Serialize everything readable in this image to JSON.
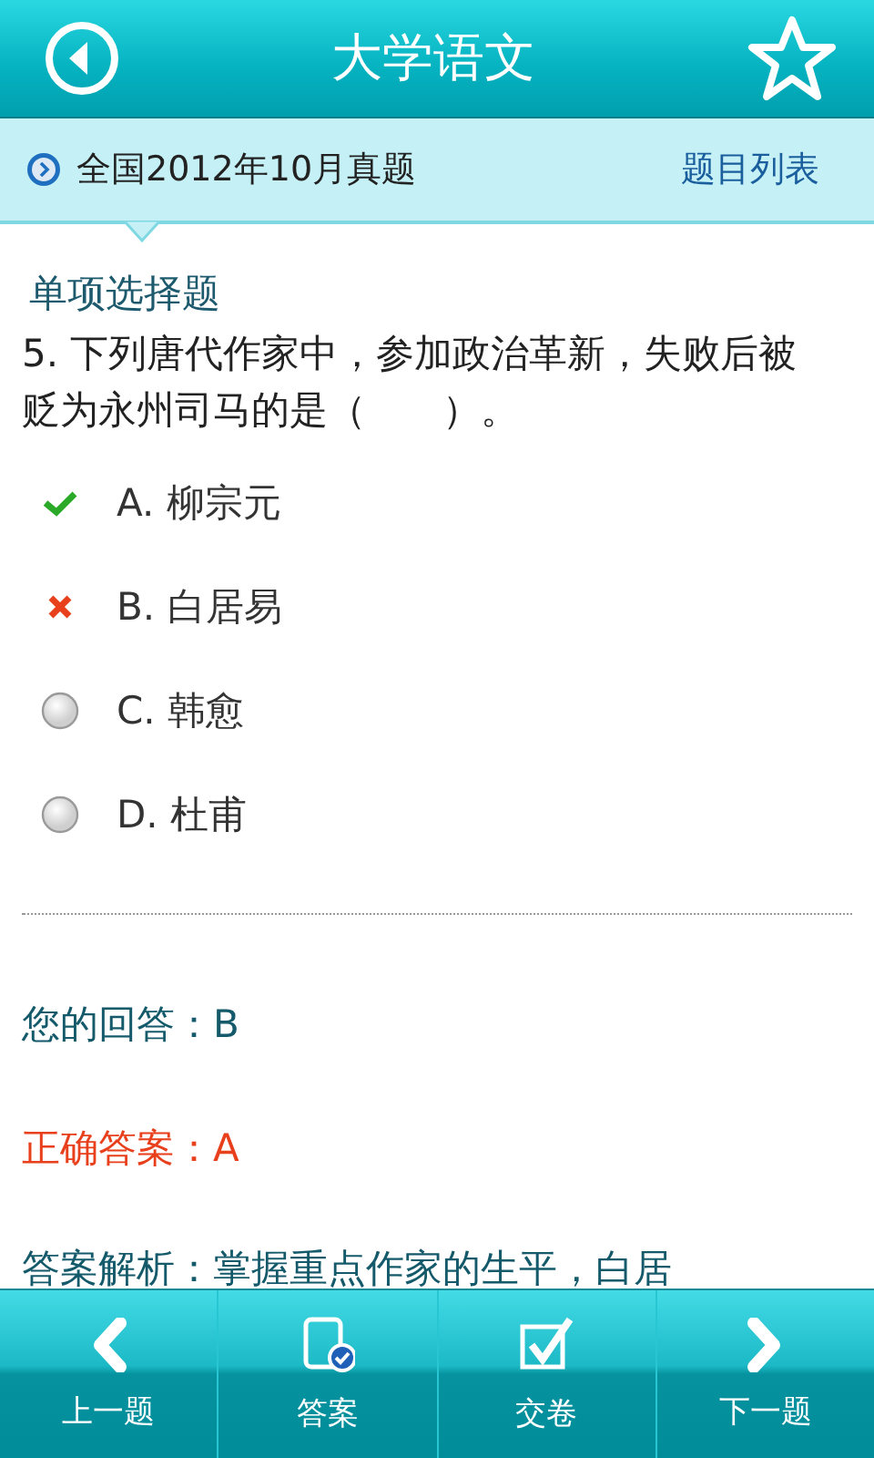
{
  "header": {
    "title": "大学语文"
  },
  "exam_bar": {
    "exam": "全国2012年10月真题",
    "list_link": "题目列表"
  },
  "question": {
    "section": "单项选择题",
    "text": "5. 下列唐代作家中，参加政治革新，失败后被贬为永州司马的是（　　）。",
    "options": [
      {
        "label": "A. 柳宗元",
        "kind": "correct"
      },
      {
        "label": "B. 白居易",
        "kind": "wrong"
      },
      {
        "label": "C. 韩愈",
        "kind": "radio"
      },
      {
        "label": "D. 杜甫",
        "kind": "radio"
      }
    ]
  },
  "your_answer": "您的回答：B",
  "correct_answer": "正确答案：A",
  "analysis": "答案解析：掌握重点作家的生平，白居",
  "toolbar": [
    {
      "label": "上一题",
      "kind": "prev"
    },
    {
      "label": "答案",
      "kind": "answer"
    },
    {
      "label": "交卷",
      "kind": "submit"
    },
    {
      "label": "下一题",
      "kind": "next"
    }
  ]
}
